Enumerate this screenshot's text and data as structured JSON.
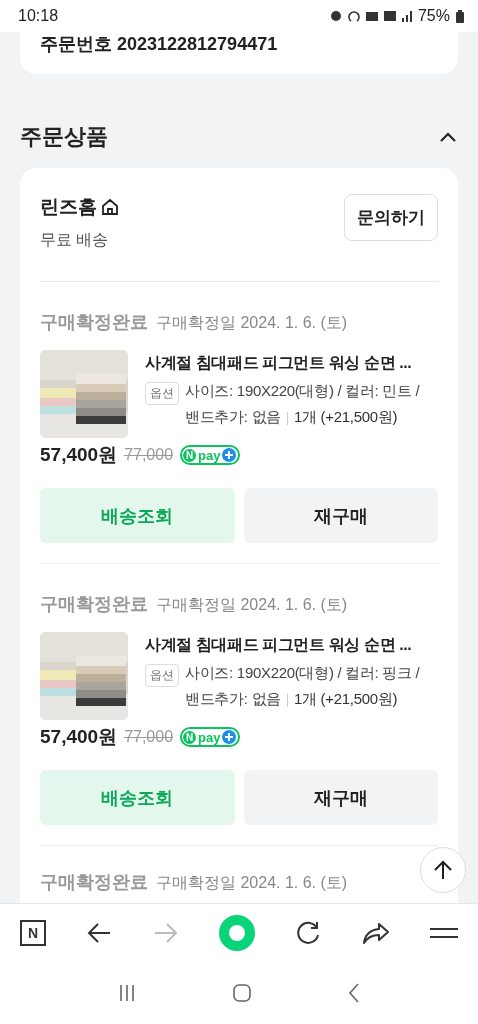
{
  "status_bar": {
    "time": "10:18",
    "battery": "75%"
  },
  "order": {
    "number": "주문번호 2023122812794471"
  },
  "section": {
    "title": "주문상품",
    "expanded": true
  },
  "store": {
    "name": "린즈홈",
    "shipping": "무료 배송",
    "inquiry_button": "문의하기"
  },
  "items": [
    {
      "status": "구매확정완료",
      "date": "구매확정일 2024. 1. 6. (토)",
      "title": "사계절 침대패드 피그먼트 워싱 순면 ...",
      "option_tag": "옵션",
      "option": "사이즈: 190X220(대형) / 컬러: 민트 / 밴드추가: 없음",
      "quantity": "1개 (+21,500원)",
      "price": "57,400원",
      "original_price": "77,000",
      "pay_badge": {
        "logo": "N",
        "label": "pay"
      },
      "buttons": [
        "배송조회",
        "재구매"
      ]
    },
    {
      "status": "구매확정완료",
      "date": "구매확정일 2024. 1. 6. (토)",
      "title": "사계절 침대패드 피그먼트 워싱 순면 ...",
      "option_tag": "옵션",
      "option": "사이즈: 190X220(대형) / 컬러: 핑크 / 밴드추가: 없음",
      "quantity": "1개 (+21,500원)",
      "price": "57,400원",
      "original_price": "77,000",
      "pay_badge": {
        "logo": "N",
        "label": "pay"
      },
      "buttons": [
        "배송조회",
        "재구매"
      ]
    }
  ],
  "next_item": {
    "status": "구매확정완료",
    "date": "구매확정일 2024. 1. 6. (토)"
  },
  "browser_bar": {
    "logo": "N",
    "forward_disabled": true
  }
}
